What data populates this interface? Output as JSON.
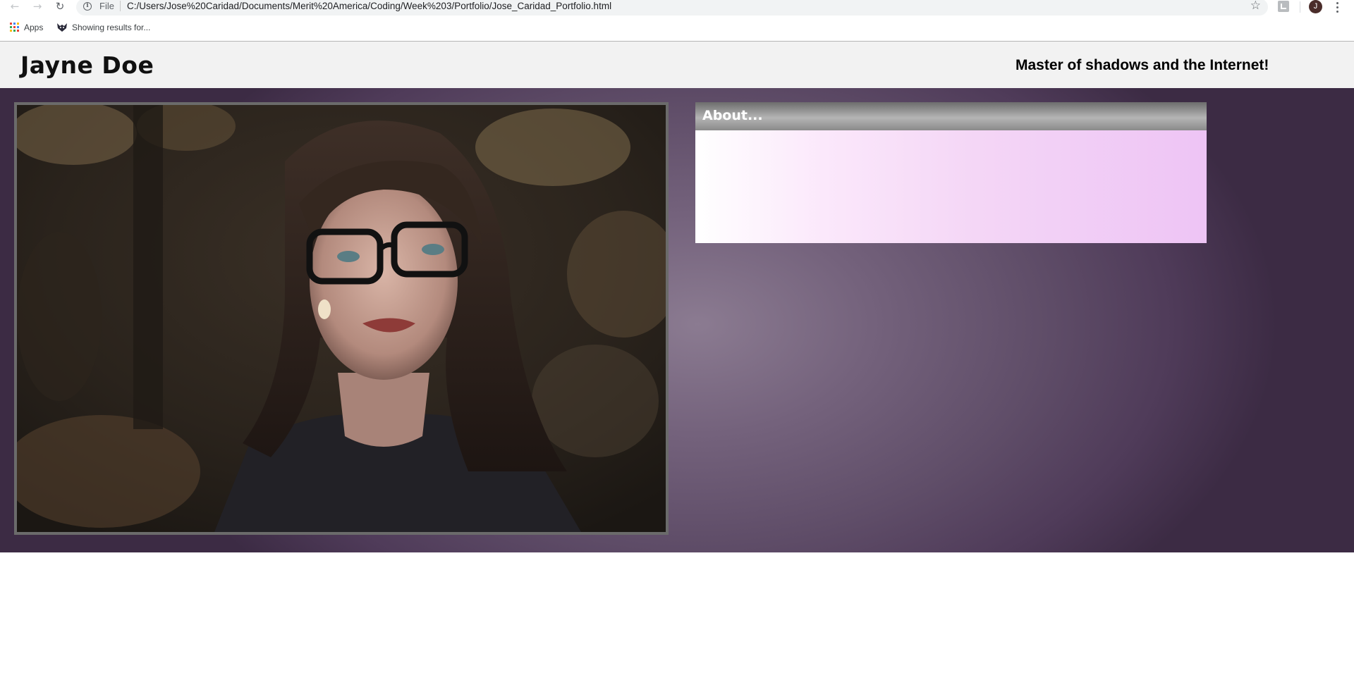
{
  "browser": {
    "nav": {
      "back_icon": "arrow-left-icon",
      "forward_icon": "arrow-right-icon",
      "reload_icon": "reload-icon"
    },
    "omnibox": {
      "info_icon": "info-icon",
      "scheme_label": "File",
      "url": "C:/Users/Jose%20Caridad/Documents/Merit%20America/Coding/Week%203/Portfolio/Jose_Caridad_Portfolio.html",
      "star_icon": "star-icon"
    },
    "profile_initial": "J",
    "bookmarks": [
      {
        "label": "Apps",
        "icon": "apps-grid-icon"
      },
      {
        "label": "Showing results for...",
        "icon": "wolf-icon"
      }
    ]
  },
  "page": {
    "header": {
      "name": "Jayne Doe",
      "tagline": "Master of shadows and the Internet!"
    },
    "about": {
      "heading": "About...",
      "body": ""
    },
    "colors": {
      "header_bg": "#f2f2f2",
      "hero_center": "#8b7b91",
      "hero_edge": "#3c2b44",
      "about_body_end": "#eec4f5"
    }
  }
}
